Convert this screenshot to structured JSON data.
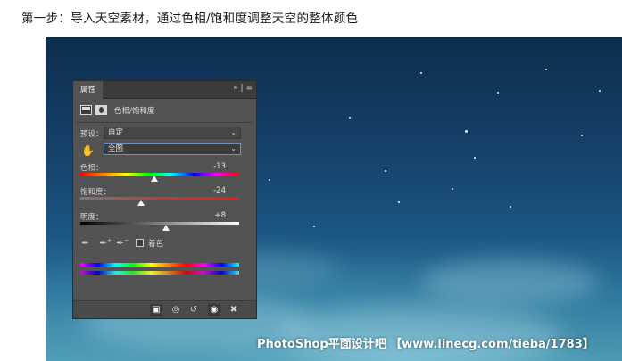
{
  "caption": "第一步：导入天空素材，通过色相/饱和度调整天空的整体颜色",
  "watermark": "PhotoShop平面设计吧 【www.linecg.com/tieba/1783】",
  "panel": {
    "tab_label": "属性",
    "menu_glyph": "»  | ≡",
    "adjustment_title": "色相/饱和度",
    "preset_label": "预设：",
    "preset_value": "自定",
    "channel_value": "全图",
    "hue": {
      "label": "色相：",
      "value": "-13",
      "level": -13,
      "min": -180,
      "max": 180
    },
    "saturation": {
      "label": "饱和度：",
      "value": "-24",
      "level": -24,
      "min": -100,
      "max": 100
    },
    "lightness": {
      "label": "明度：",
      "value": "+8",
      "level": 8,
      "min": -100,
      "max": 100
    },
    "colorize_label": "着色",
    "colorize_checked": false
  },
  "icons": {
    "adjustment": "adjustment-layer-icon",
    "mask": "mask-icon",
    "hand": "targeted-adjustment-hand-icon",
    "eyedropper": "eyedropper-icon",
    "eyedropper_plus": "eyedropper-plus-icon",
    "eyedropper_minus": "eyedropper-minus-icon",
    "clip": "clip-to-layer-icon",
    "view_previous": "view-previous-state-icon",
    "reset": "reset-icon",
    "visibility": "eye-icon",
    "delete": "trash-icon"
  }
}
